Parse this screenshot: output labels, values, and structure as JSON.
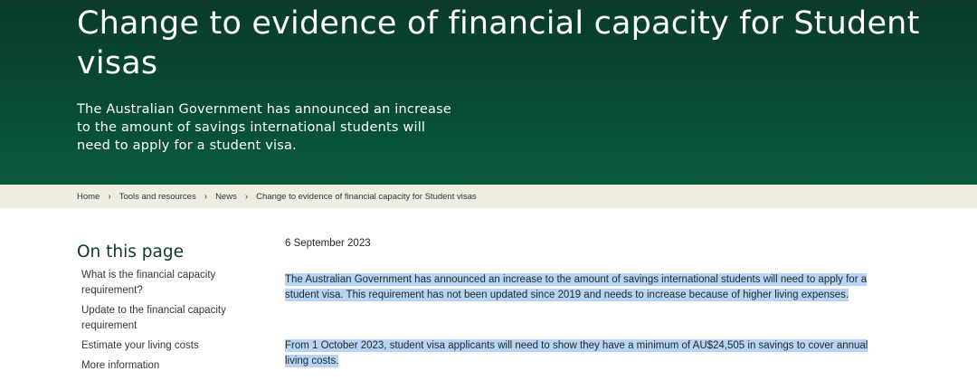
{
  "hero": {
    "title": "Change to evidence of financial capacity for Student visas",
    "intro": "The Australian Government has announced an increase to the amount of savings international students will need to apply for a student visa."
  },
  "breadcrumb": [
    "Home",
    "Tools and resources",
    "News",
    "Change to evidence of financial capacity for Student visas"
  ],
  "sidebar": {
    "title": "On this page",
    "items": [
      "What is the financial capacity requirement?",
      "Update to the financial capacity requirement",
      "Estimate your living costs",
      "More information"
    ]
  },
  "article": {
    "date": "6 September 2023",
    "paragraphs": [
      "The Australian Government has announced an increase to the amount of savings international students will need to apply for a student visa. This requirement has not been updated since 2019 and needs to increase because of higher living expenses.",
      "From 1 October 2023, student visa applicants will need to show they have a minimum of AU$24,505 in savings to cover annual living costs."
    ]
  },
  "colors": {
    "hero_bg": "#074b35",
    "breadcrumb_bg": "#efece2",
    "selection_highlight": "#b7d3f5"
  }
}
